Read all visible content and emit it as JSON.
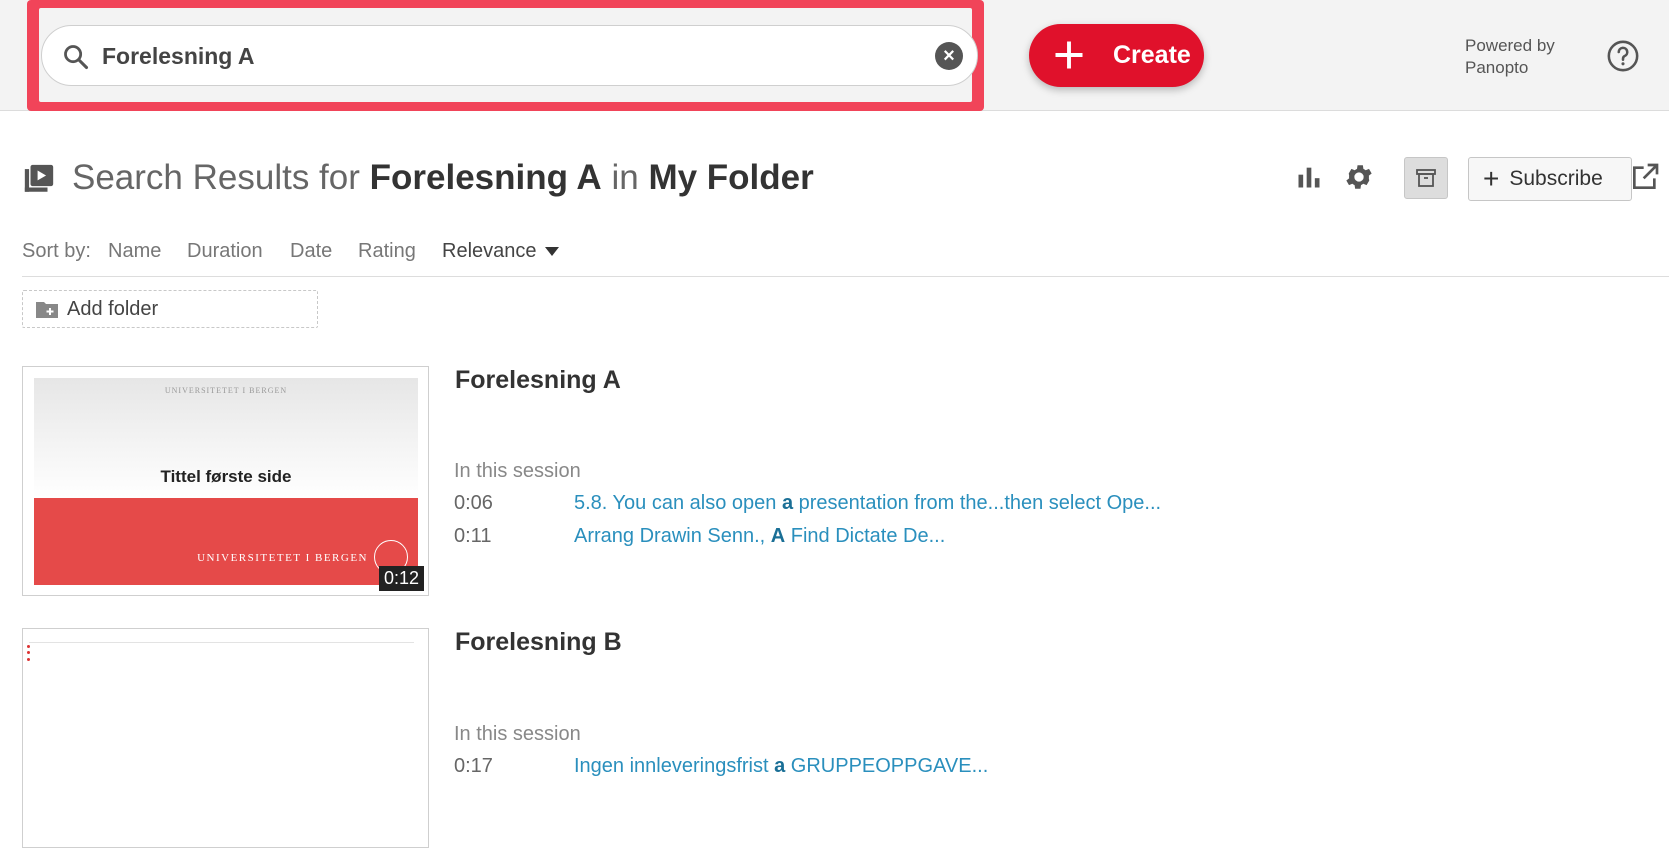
{
  "search": {
    "value": "Forelesning A",
    "clear_icon": "clear-icon"
  },
  "header": {
    "create_label": "Create",
    "powered_line1": "Powered by",
    "powered_line2": "Panopto",
    "highlight_color": "#f14459",
    "accent_color": "#e0112b"
  },
  "page": {
    "title_prefix": "Search Results for",
    "title_query": "Forelesning A",
    "title_in": "in",
    "title_folder": "My Folder",
    "subscribe_label": "Subscribe"
  },
  "sort": {
    "label": "Sort by:",
    "options": [
      "Name",
      "Duration",
      "Date",
      "Rating",
      "Relevance"
    ],
    "active": "Relevance"
  },
  "add_folder_label": "Add folder",
  "sessions": [
    {
      "title": "Forelesning A",
      "thumb_header": "UNIVERSITETET I BERGEN",
      "thumb_title": "Tittel første side",
      "thumb_footer": "UNIVERSITETET I BERGEN",
      "duration": "0:12",
      "in_session_label": "In this session",
      "hits": [
        {
          "time": "0:06",
          "pre": "5.8. You can also open ",
          "match": "a",
          "post": " presentation from the...then select Ope..."
        },
        {
          "time": "0:11",
          "pre": "Arrang Drawin Senn., ",
          "match": "A",
          "post": " Find Dictate De..."
        }
      ]
    },
    {
      "title": "Forelesning B",
      "in_session_label": "In this session",
      "hits": [
        {
          "time": "0:17",
          "pre": "Ingen innleveringsfrist ",
          "match": "a",
          "post": " GRUPPEOPPGAVE..."
        }
      ]
    }
  ]
}
